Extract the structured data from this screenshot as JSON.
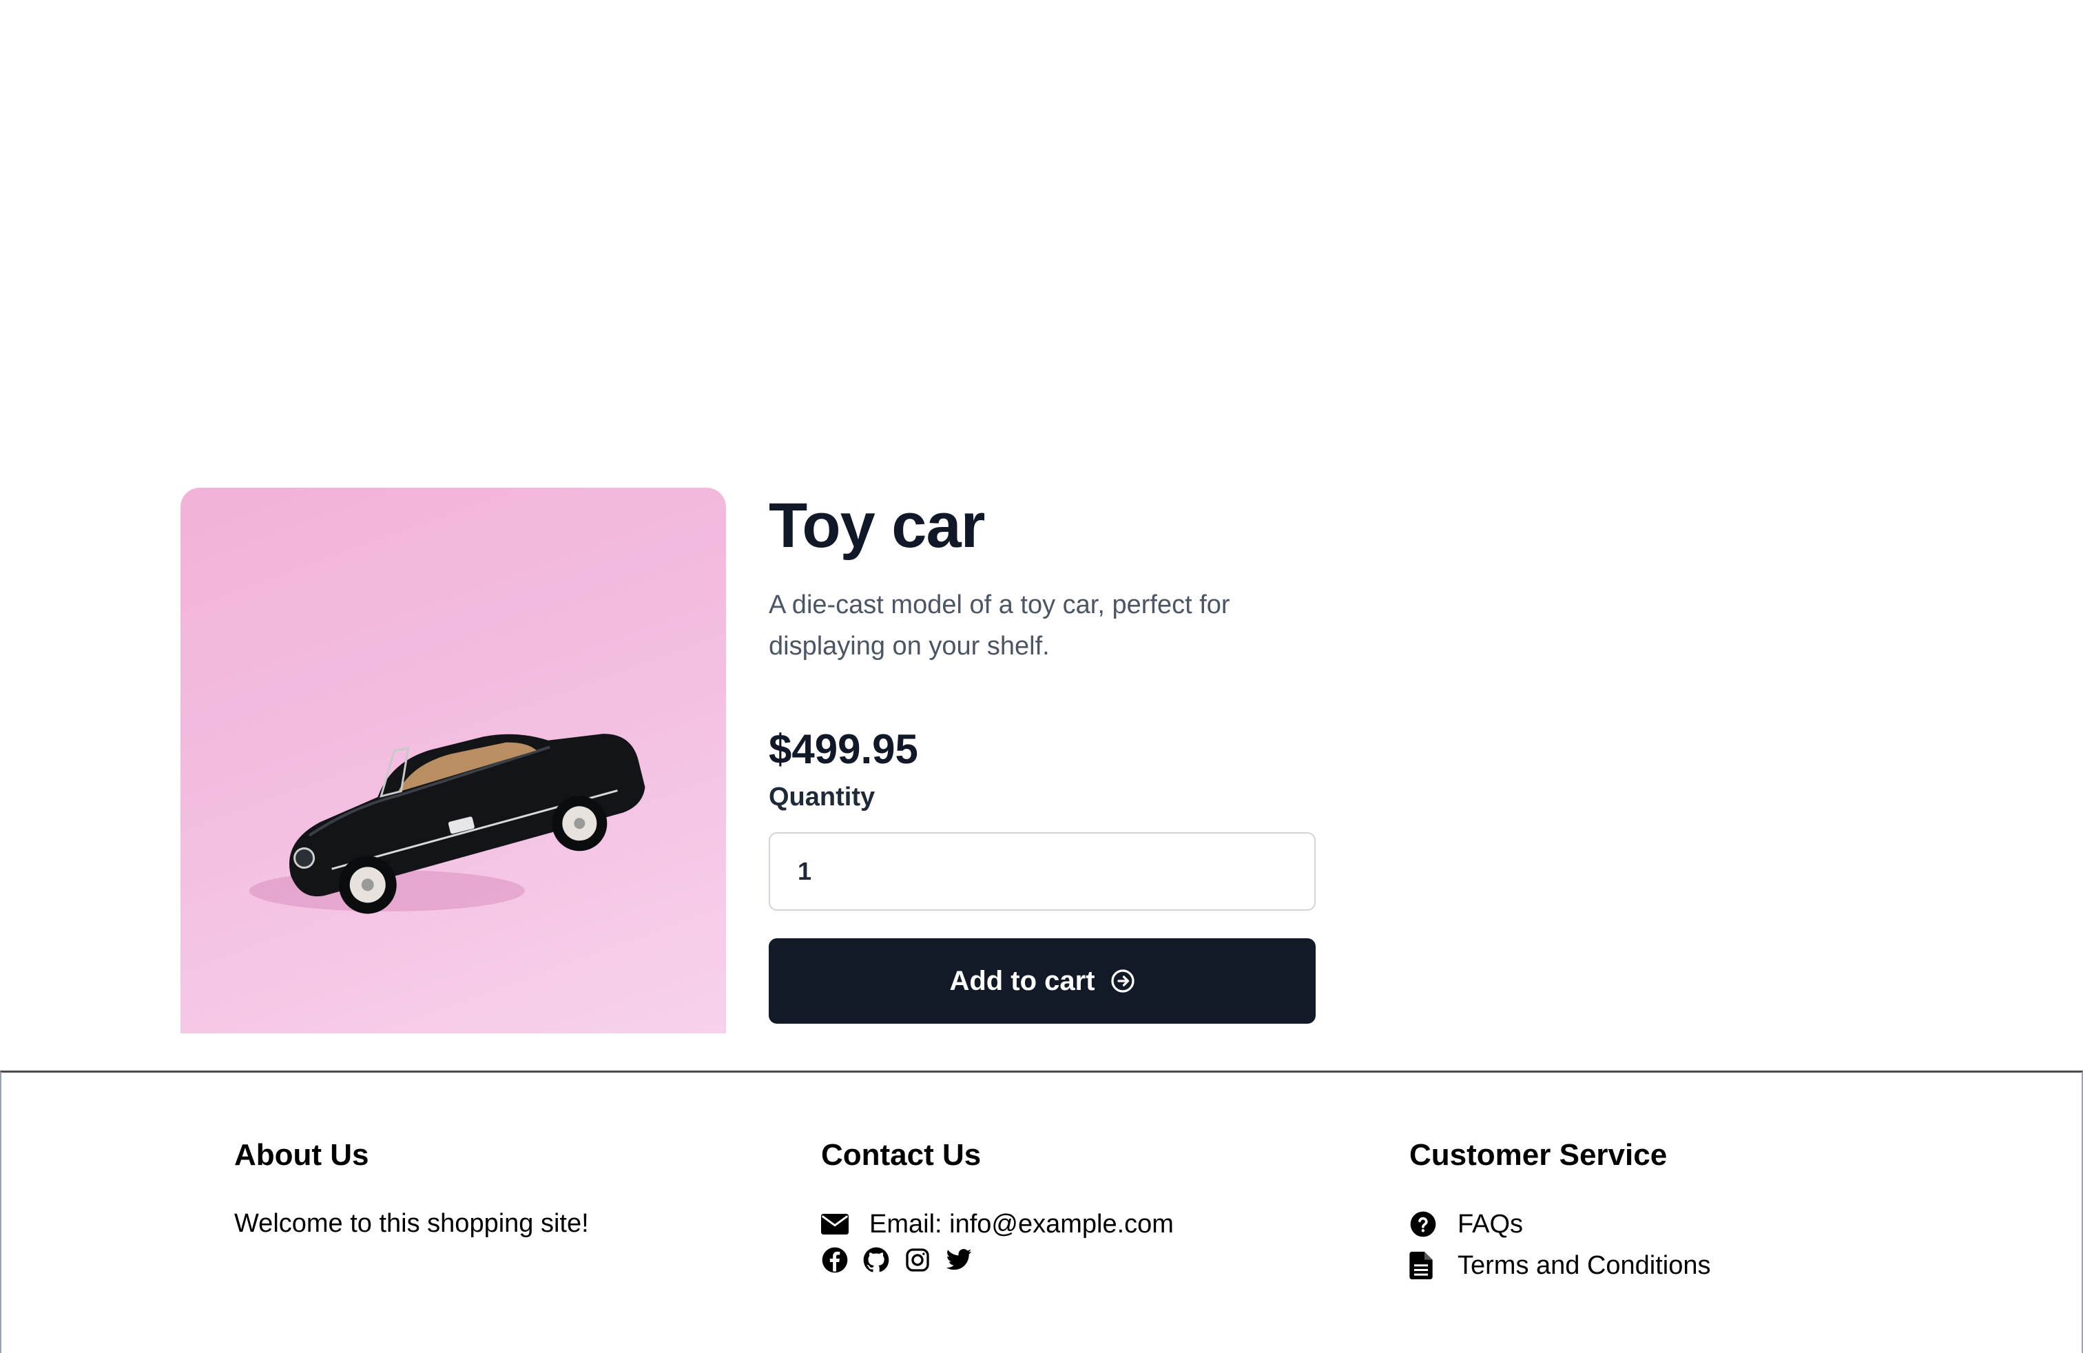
{
  "product": {
    "image_alt": "Black toy convertible car on pink background",
    "title": "Toy car",
    "description": "A die-cast model of a toy car, perfect for displaying on your shelf.",
    "price": "$499.95",
    "quantity_label": "Quantity",
    "quantity_value": "1",
    "add_to_cart_label": "Add to cart",
    "add_to_cart_icon": "arrow-right-circle-icon"
  },
  "footer": {
    "about": {
      "heading": "About Us",
      "text": "Welcome to this shopping site!"
    },
    "contact": {
      "heading": "Contact Us",
      "email_label": "Email: info@example.com",
      "email_icon": "envelope-icon",
      "social_icons": [
        "facebook-icon",
        "github-icon",
        "instagram-icon",
        "twitter-icon"
      ]
    },
    "service": {
      "heading": "Customer Service",
      "links": [
        {
          "label": "FAQs",
          "icon": "question-circle-icon"
        },
        {
          "label": "Terms and Conditions",
          "icon": "document-icon"
        }
      ]
    }
  },
  "colors": {
    "button_bg": "#131a27",
    "image_bg": "#f3bde0",
    "text_primary": "#111827",
    "text_secondary": "#4b5563"
  }
}
